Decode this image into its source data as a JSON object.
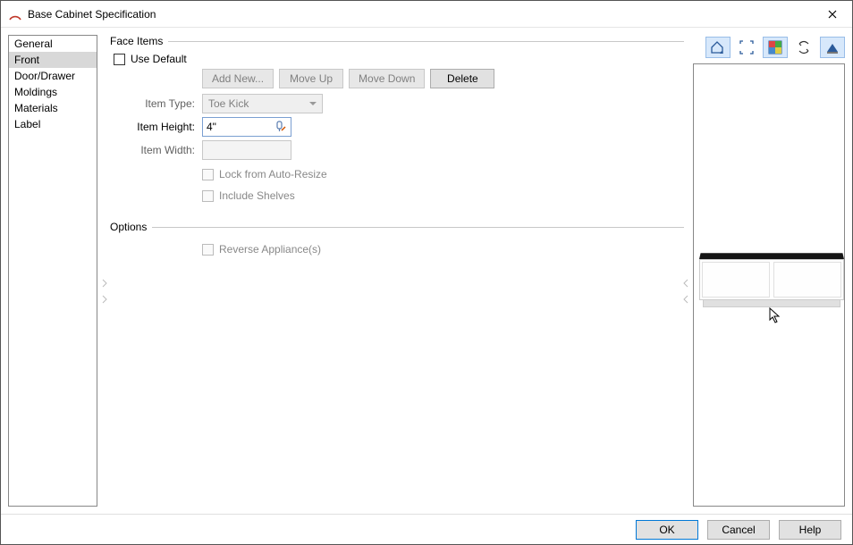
{
  "dialog": {
    "title": "Base Cabinet Specification"
  },
  "nav": {
    "items": [
      "General",
      "Front",
      "Door/Drawer",
      "Moldings",
      "Materials",
      "Label"
    ],
    "selected": "Front"
  },
  "faceItems": {
    "group_label": "Face Items",
    "use_default_label": "Use Default",
    "use_default_checked": false,
    "buttons": {
      "add_new": "Add New...",
      "move_up": "Move Up",
      "move_down": "Move Down",
      "delete": "Delete"
    },
    "item_type": {
      "label": "Item Type:",
      "value": "Toe Kick"
    },
    "item_height": {
      "label": "Item Height:",
      "value": "4\""
    },
    "item_width": {
      "label": "Item Width:",
      "value": ""
    },
    "lock_auto_resize_label": "Lock from Auto-Resize",
    "include_shelves_label": "Include Shelves"
  },
  "options": {
    "group_label": "Options",
    "reverse_appliance_label": "Reverse Appliance(s)"
  },
  "toolbar_icons": [
    "home-view-icon",
    "zoom-extents-icon",
    "color-toggle-icon",
    "orbit-icon",
    "elevation-icon"
  ],
  "footer": {
    "ok": "OK",
    "cancel": "Cancel",
    "help": "Help"
  }
}
